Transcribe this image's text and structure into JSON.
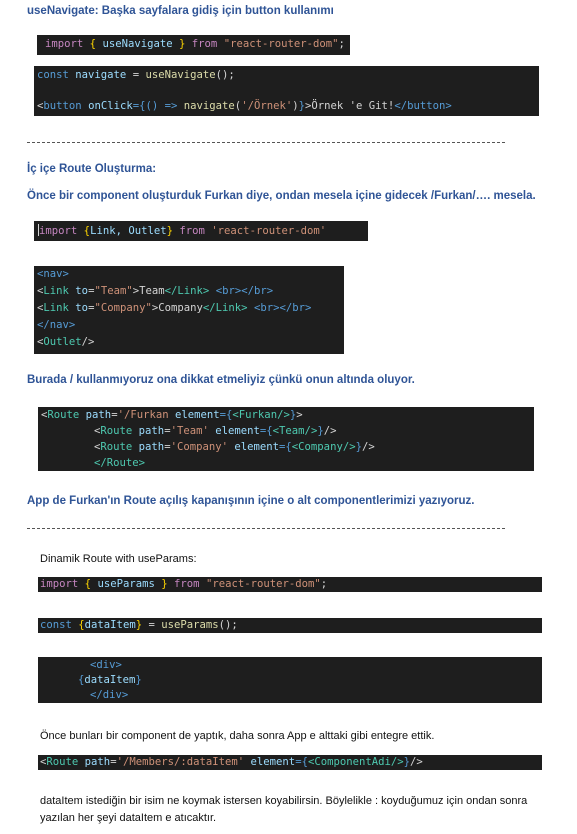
{
  "s1": {
    "heading": "useNavigate: Başka sayfalara gidiş için button kullanımı",
    "import": {
      "kw": "import",
      "b1": "{",
      "name": "useNavigate",
      "b2": "}",
      "from": "from",
      "str": "\"react-router-dom\"",
      "semi": ";"
    },
    "l1": {
      "kw": "const",
      "var": "navigate",
      "eq": " = ",
      "fn": "useNavigate",
      "tail": "();"
    },
    "l2": {
      "lt": "<",
      "tag": "button",
      "attr": "onClick",
      "eqb": "={",
      "arrowp": "() =>",
      "fn": "navigate",
      "op": "(",
      "str": "'/Örnek'",
      "cp": ")",
      "cb": "}",
      "gt": ">",
      "text": "Örnek 'e Git!",
      "endtag": "</button>"
    }
  },
  "s2": {
    "heading": "İç içe Route Oluşturma:",
    "para": "Önce bir component oluşturduk Furkan diye, ondan mesela içine gidecek /Furkan/…. mesela.",
    "import": {
      "kw": "import",
      "b1": "{",
      "names": "Link, Outlet",
      "b2": "}",
      "from": "from",
      "str": "'react-router-dom'"
    },
    "nav": [
      {
        "open": "<nav>"
      },
      {
        "lt": "<",
        "tag": "Link",
        "attr": "to",
        "eq": "=",
        "str": "\"Team\"",
        "gt": ">",
        "text": "Team",
        "close": "</Link>",
        "br": "<br></br>"
      },
      {
        "lt": "<",
        "tag": "Link",
        "attr": "to",
        "eq": "=",
        "str": "\"Company\"",
        "gt": ">",
        "text": "Company",
        "close": "</Link>",
        "br": "<br></br>"
      },
      {
        "open": "</nav>"
      },
      {
        "lt": "<",
        "tag": "Outlet",
        "end": "/>"
      }
    ],
    "note": "Burada / kullanmıyoruz ona dikkat etmeliyiz çünkü onun altında oluyor.",
    "routes": {
      "r1": {
        "lt": "<",
        "tag": "Route",
        "attr": "path",
        "eq": "=",
        "str": "'/Furkan",
        "attr2": "element",
        "eqb": "={",
        "comp": "<Furkan/>",
        "cb": "}",
        "gt": ">"
      },
      "r2": {
        "lt": "<",
        "tag": "Route",
        "attr": "path",
        "eq": "=",
        "str": "'Team'",
        "attr2": "element",
        "eqb": "={",
        "comp": "<Team/>",
        "cb": "}",
        "end": "/>"
      },
      "r3": {
        "lt": "<",
        "tag": "Route",
        "attr": "path",
        "eq": "=",
        "str": "'Company'",
        "attr2": "element",
        "eqb": "={",
        "comp": "<Company/>",
        "cb": "}",
        "end": "/>"
      },
      "r4": {
        "close": "</Route>"
      }
    },
    "after": "App de Furkan'ın Route açılış kapanışının içine o alt componentlerimizi yazıyoruz."
  },
  "s3": {
    "title": "Dinamik Route with useParams:",
    "import": {
      "kw": "import",
      "b1": "{",
      "name": "useParams",
      "b2": "}",
      "from": "from",
      "str": "\"react-router-dom\"",
      "semi": ";"
    },
    "const": {
      "kw": "const",
      "b1": "{",
      "name": "dataItem",
      "b2": "}",
      "eq": " = ",
      "fn": "useParams",
      "tail": "();"
    },
    "div": {
      "open": "<div>",
      "b1": "{",
      "name": "dataItem",
      "b2": "}",
      "close": "</div>"
    },
    "para1": "Önce bunları bir component de yaptık, daha sonra App e alttaki gibi entegre ettik.",
    "route": {
      "lt": "<",
      "tag": "Route",
      "attr": "path",
      "eq": "=",
      "str": "'/Members/:dataItem'",
      "attr2": "element",
      "eqb": "={",
      "comp": "<ComponentAdi/>",
      "cb": "}",
      "end": "/>"
    },
    "para2a": "dataItem istediğin bir isim ne koymak istersen koyabilirsin. Böylelikle : koyduğumuz için ondan sonra",
    "para2b": "yazılan her şeyi dataItem e atıcaktır."
  }
}
